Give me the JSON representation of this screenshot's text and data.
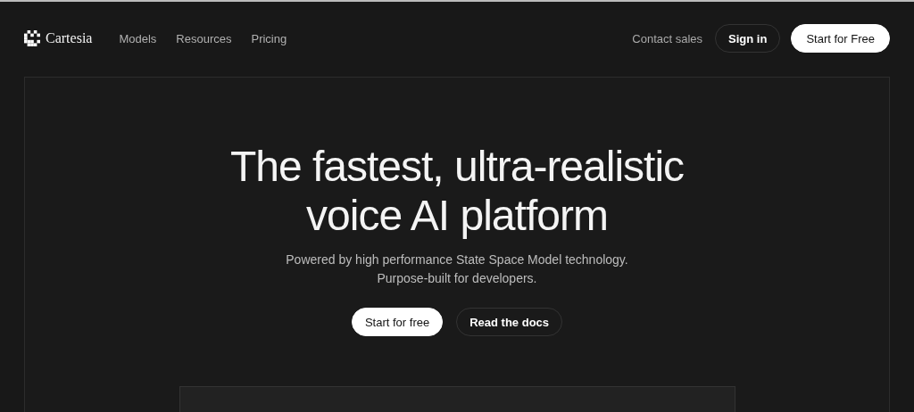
{
  "nav": {
    "brand": "Cartesia",
    "links": [
      "Models",
      "Resources",
      "Pricing"
    ],
    "contact": "Contact sales",
    "sign_in": "Sign in",
    "cta": "Start for Free"
  },
  "hero": {
    "title_lines": [
      "The fastest, ultra-realistic",
      "voice AI platform"
    ],
    "subtitle_lines": [
      "Powered by high performance State Space Model technology.",
      "Purpose-built for developers."
    ],
    "buttons": [
      {
        "label": "Start for free",
        "kind": "primary"
      },
      {
        "label": "Read the docs",
        "kind": "secondary"
      }
    ]
  }
}
